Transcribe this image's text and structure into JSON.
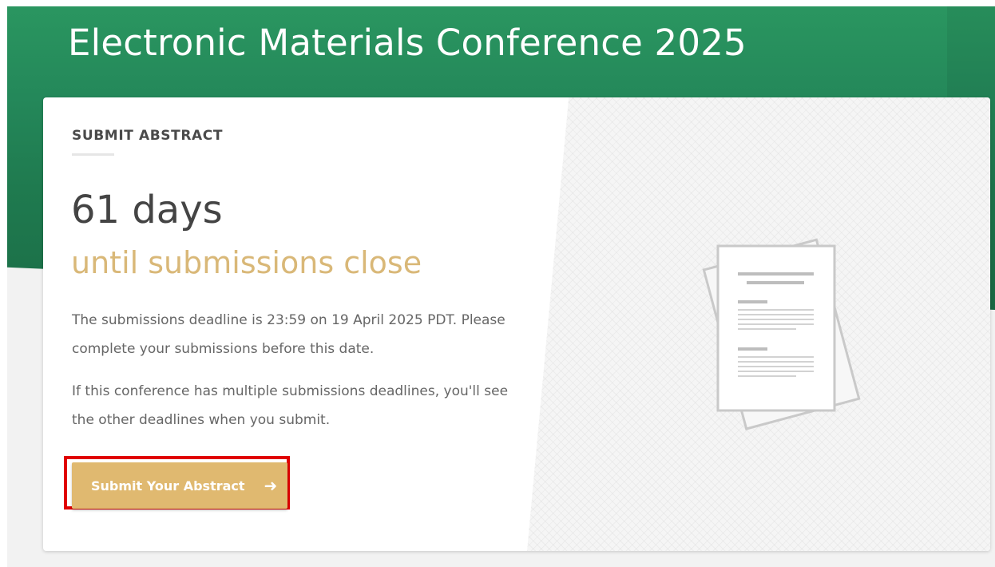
{
  "header": {
    "title": "Electronic Materials Conference 2025"
  },
  "card": {
    "section_label": "SUBMIT ABSTRACT",
    "days_count": "61 days",
    "days_subtitle": "until submissions close",
    "paragraph_1": "The submissions deadline is 23:59 on 19 April 2025 PDT. Please complete your submissions before this date.",
    "paragraph_2": "If this conference has multiple submissions deadlines, you'll see the other deadlines when you submit.",
    "submit_button": {
      "label": "Submit Your Abstract",
      "icon": "arrow-right-icon"
    },
    "illustration_icon": "document-icon"
  },
  "colors": {
    "header_green": "#24885a",
    "accent_gold": "#d9b878",
    "button_gold": "#e0b970",
    "highlight_red": "#e00000"
  }
}
